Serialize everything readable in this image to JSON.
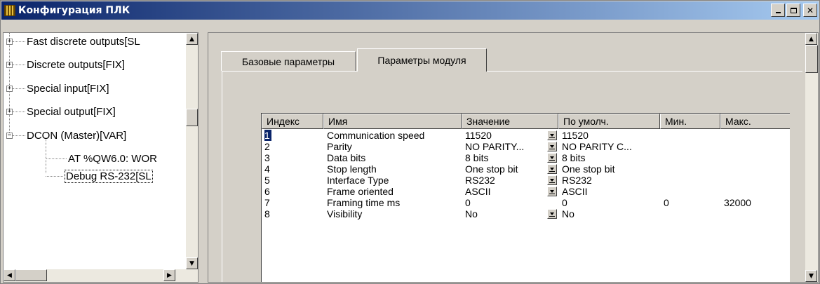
{
  "window": {
    "title": "Конфигурация ПЛК",
    "icon": "plc-config-icon",
    "controls": [
      "minimize",
      "maximize",
      "close"
    ]
  },
  "tree": {
    "items": [
      {
        "label": "Fast discrete outputs[SL",
        "expander": "+"
      },
      {
        "label": "Discrete outputs[FIX]",
        "expander": "+"
      },
      {
        "label": "Special input[FIX]",
        "expander": "+"
      },
      {
        "label": "Special output[FIX]",
        "expander": "+"
      },
      {
        "label": "DCON (Master)[VAR]",
        "expander": "−"
      },
      {
        "label": "AT %QW6.0: WOR"
      },
      {
        "label": "Debug RS-232[SL"
      }
    ]
  },
  "tabs": [
    {
      "label": "Базовые параметры",
      "active": false
    },
    {
      "label": "Параметры модуля",
      "active": true
    }
  ],
  "grid": {
    "columns": [
      "Индекс",
      "Имя",
      "Значение",
      "По умолч.",
      "Мин.",
      "Макс."
    ],
    "rows": [
      {
        "index": "1",
        "name": "Communication speed",
        "value": "11520",
        "default": "11520",
        "min": "",
        "max": ""
      },
      {
        "index": "2",
        "name": "Parity",
        "value": "NO PARITY...",
        "default": "NO PARITY C...",
        "min": "",
        "max": ""
      },
      {
        "index": "3",
        "name": "Data bits",
        "value": "8 bits",
        "default": "8 bits",
        "min": "",
        "max": ""
      },
      {
        "index": "4",
        "name": "Stop length",
        "value": "One stop bit",
        "default": "One stop bit",
        "min": "",
        "max": ""
      },
      {
        "index": "5",
        "name": "Interface Type",
        "value": "RS232",
        "default": "RS232",
        "min": "",
        "max": ""
      },
      {
        "index": "6",
        "name": "Frame oriented",
        "value": "ASCII",
        "default": "ASCII",
        "min": "",
        "max": ""
      },
      {
        "index": "7",
        "name": "Framing time ms",
        "value": "0",
        "default": "0",
        "min": "0",
        "max": "32000"
      },
      {
        "index": "8",
        "name": "Visibility",
        "value": "No",
        "default": "No",
        "min": "",
        "max": ""
      }
    ]
  },
  "colors": {
    "title_bar_start": "#0a246a",
    "title_bar_end": "#a6caf0",
    "selection": "#0a246a",
    "face": "#d4d0c8"
  }
}
